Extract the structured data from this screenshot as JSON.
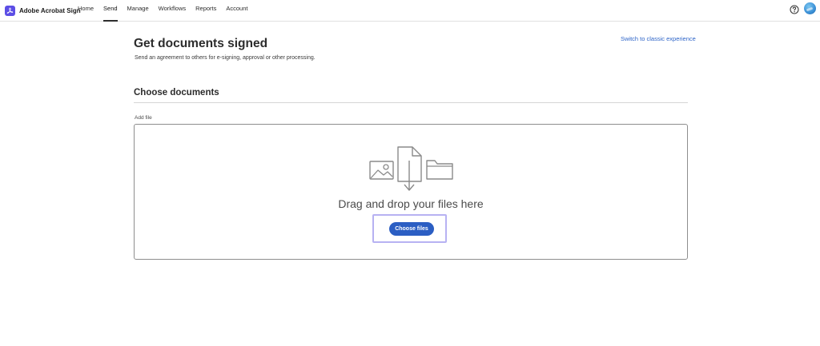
{
  "header": {
    "brand_name": "Adobe Acrobat Sign",
    "nav": [
      {
        "label": "Home",
        "active": false
      },
      {
        "label": "Send",
        "active": true
      },
      {
        "label": "Manage",
        "active": false
      },
      {
        "label": "Workflows",
        "active": false
      },
      {
        "label": "Reports",
        "active": false
      },
      {
        "label": "Account",
        "active": false
      }
    ],
    "help_icon": "help-circle-icon",
    "avatar_icon": "user-avatar"
  },
  "page": {
    "title": "Get documents signed",
    "subtitle": "Send an agreement to others for e-signing, approval or other processing.",
    "switch_link": "Switch to classic experience"
  },
  "documents": {
    "section_title": "Choose documents",
    "add_file_label": "Add file",
    "drop_text": "Drag and drop your files here",
    "choose_button": "Choose files",
    "illustration_icons": [
      "image-icon",
      "document-download-icon",
      "folder-icon"
    ]
  },
  "colors": {
    "brand": "#5c4ee5",
    "primary_button": "#2b5ec3",
    "link": "#2d64c8",
    "focus_ring": "#b7b2f2"
  }
}
